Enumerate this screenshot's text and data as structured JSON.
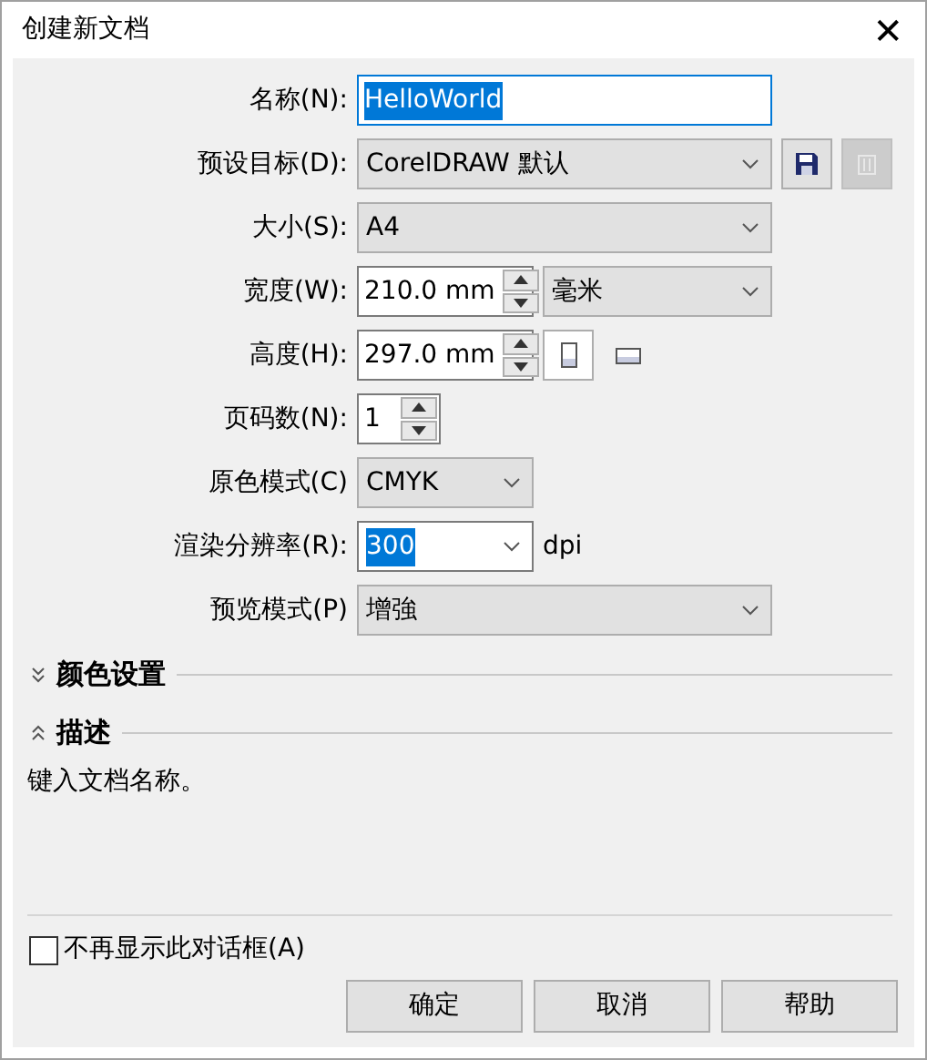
{
  "window": {
    "title": "创建新文档",
    "close": "✕"
  },
  "fields": [
    {
      "kind": "text",
      "label": "名称(N):",
      "value": "HelloWorld",
      "selected": true
    },
    {
      "kind": "preset",
      "label": "预设目标(D):",
      "value": "CorelDRAW 默认",
      "save_disabled": false,
      "delete_disabled": true
    },
    {
      "kind": "select",
      "label": "大小(S):",
      "value": "A4"
    },
    {
      "kind": "spin_unit",
      "label": "宽度(W):",
      "value": "210.0 mm",
      "unit": "毫米"
    },
    {
      "kind": "spin_orient",
      "label": "高度(H):",
      "value": "297.0 mm",
      "orientations": [
        {
          "kind": "portrait",
          "selected": true
        },
        {
          "kind": "landscape",
          "selected": false
        }
      ]
    },
    {
      "kind": "spin_small",
      "label": "页码数(N):",
      "value": "1"
    },
    {
      "kind": "select_small",
      "label": "原色模式(C)",
      "value": "CMYK"
    },
    {
      "kind": "combo",
      "label": "渲染分辨率(R):",
      "value": "300",
      "selected": true,
      "suffix": "dpi"
    },
    {
      "kind": "select",
      "label": "预览模式(P)",
      "value": "增強"
    }
  ],
  "sections": [
    {
      "title": "颜色设置",
      "expanded": false
    },
    {
      "title": "描述",
      "expanded": true,
      "text": "键入文档名称。"
    }
  ],
  "checkbox": {
    "label": "不再显示此对话框(A)",
    "checked": false
  },
  "buttons": [
    "确定",
    "取消",
    "帮助"
  ]
}
